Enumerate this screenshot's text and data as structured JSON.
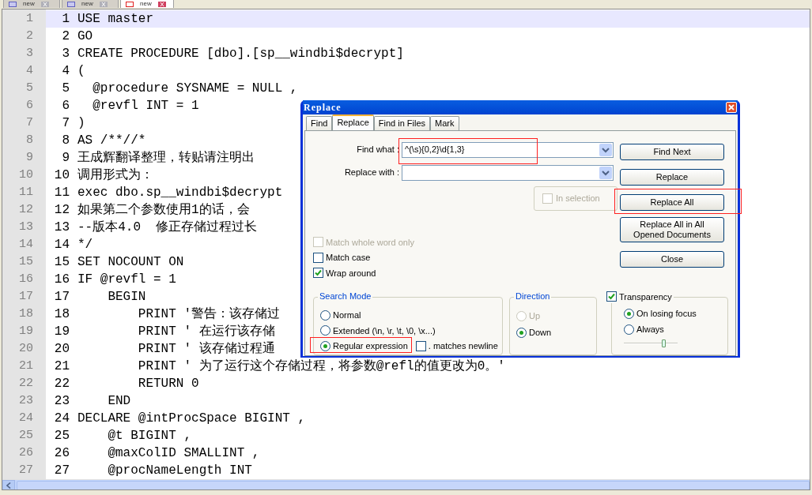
{
  "tabs": [
    {
      "label": "new",
      "selected": false
    },
    {
      "label": "new",
      "selected": false
    },
    {
      "label": "new",
      "selected": true
    }
  ],
  "lines": [
    {
      "gutter": "1",
      "number": "1",
      "code": "USE master",
      "current": true
    },
    {
      "gutter": "2",
      "number": "2",
      "code": "GO",
      "current": false
    },
    {
      "gutter": "3",
      "number": "3",
      "code": "CREATE PROCEDURE [dbo].[sp__windbi$decrypt]",
      "current": false
    },
    {
      "gutter": "4",
      "number": "4",
      "code": "(",
      "current": false
    },
    {
      "gutter": "5",
      "number": "5",
      "code": "  @procedure SYSNAME = NULL ,",
      "current": false
    },
    {
      "gutter": "6",
      "number": "6",
      "code": "  @revfl INT = 1",
      "current": false
    },
    {
      "gutter": "7",
      "number": "7",
      "code": ")",
      "current": false
    },
    {
      "gutter": "8",
      "number": "8",
      "code": "AS /**//*",
      "current": false
    },
    {
      "gutter": "9",
      "number": "9",
      "code": "王成辉翻译整理，转贴请注明出",
      "current": false
    },
    {
      "gutter": "10",
      "number": "10",
      "code": "调用形式为：",
      "current": false
    },
    {
      "gutter": "11",
      "number": "11",
      "code": "exec dbo.sp__windbi$decrypt",
      "current": false
    },
    {
      "gutter": "12",
      "number": "12",
      "code": "如果第二个参数使用1的话，会",
      "current": false
    },
    {
      "gutter": "13",
      "number": "13",
      "code": "--版本4.0  修正存储过程过长",
      "current": false
    },
    {
      "gutter": "14",
      "number": "14",
      "code": "*/",
      "current": false
    },
    {
      "gutter": "15",
      "number": "15",
      "code": "SET NOCOUNT ON",
      "current": false
    },
    {
      "gutter": "16",
      "number": "16",
      "code": "IF @revfl = 1",
      "current": false
    },
    {
      "gutter": "17",
      "number": "17",
      "code": "    BEGIN",
      "current": false
    },
    {
      "gutter": "18",
      "number": "18",
      "code": "        PRINT '警告：该存储过",
      "current": false
    },
    {
      "gutter": "19",
      "number": "19",
      "code": "        PRINT ' 在运行该存储",
      "current": false
    },
    {
      "gutter": "20",
      "number": "20",
      "code": "        PRINT ' 该存储过程通",
      "current": false
    },
    {
      "gutter": "21",
      "number": "21",
      "code": "        PRINT ' 为了运行这个存储过程，将参数@refl的值更改为0。'",
      "current": false
    },
    {
      "gutter": "22",
      "number": "22",
      "code": "        RETURN 0",
      "current": false
    },
    {
      "gutter": "23",
      "number": "23",
      "code": "    END",
      "current": false
    },
    {
      "gutter": "24",
      "number": "24",
      "code": "DECLARE @intProcSpace BIGINT ,",
      "current": false
    },
    {
      "gutter": "25",
      "number": "25",
      "code": "    @t BIGINT ,",
      "current": false
    },
    {
      "gutter": "26",
      "number": "26",
      "code": "    @maxColID SMALLINT ,",
      "current": false
    },
    {
      "gutter": "27",
      "number": "27",
      "code": "    @procNameLength INT",
      "current": false
    }
  ],
  "dialog": {
    "title": "Replace",
    "tabs": [
      {
        "label": "Find",
        "selected": false
      },
      {
        "label": "Replace",
        "selected": true
      },
      {
        "label": "Find in Files",
        "selected": false
      },
      {
        "label": "Mark",
        "selected": false
      }
    ],
    "find_what": {
      "label": "Find what :",
      "value": "^(\\s){0,2}\\d{1,3}",
      "highlighted": true
    },
    "replace_with": {
      "label": "Replace with :"
    },
    "in_selection": {
      "label": "In selection",
      "checked": false,
      "disabled": true
    },
    "buttons": [
      {
        "label": "Find Next",
        "highlighted": false
      },
      {
        "label": "Replace",
        "highlighted": false
      },
      {
        "label": "Replace All",
        "highlighted": true
      },
      {
        "label": "Replace All in All Opened Documents",
        "highlighted": false
      },
      {
        "label": "Close",
        "highlighted": false
      }
    ],
    "options": [
      {
        "label": "Match whole word only",
        "checked": false,
        "disabled": true
      },
      {
        "label": "Match case",
        "checked": false,
        "disabled": false
      },
      {
        "label": "Wrap around",
        "checked": true,
        "disabled": false
      }
    ],
    "search_mode": {
      "title": "Search Mode",
      "options": [
        {
          "label": "Normal",
          "selected": false,
          "highlighted": false
        },
        {
          "label": "Extended (\\n, \\r, \\t, \\0, \\x...)",
          "selected": false,
          "highlighted": false
        },
        {
          "label": "Regular expression",
          "selected": true,
          "highlighted": true
        }
      ],
      "dot_newline": {
        "label": ". matches newline",
        "checked": false
      }
    },
    "direction": {
      "title": "Direction",
      "options": [
        {
          "label": "Up",
          "selected": false,
          "disabled": true
        },
        {
          "label": "Down",
          "selected": true,
          "disabled": false
        }
      ]
    },
    "transparency": {
      "label": "Transparency",
      "checked": true,
      "options": [
        {
          "label": "On losing focus",
          "selected": true
        },
        {
          "label": "Always",
          "selected": false
        }
      ],
      "level": 0.75
    }
  }
}
